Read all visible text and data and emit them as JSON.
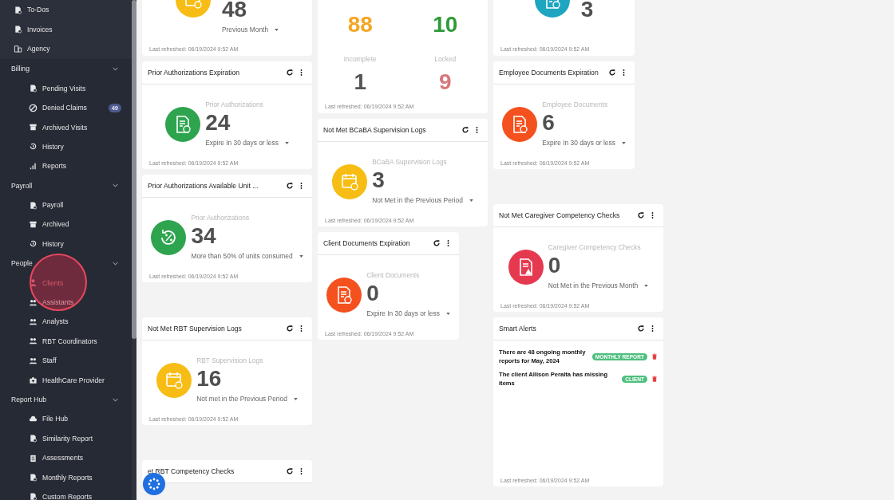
{
  "sidebar": {
    "top_items": [
      {
        "label": "To-Dos",
        "selected": false
      },
      {
        "label": "Invoices",
        "selected": false
      },
      {
        "label": "Agency",
        "selected": false
      }
    ],
    "groups": [
      {
        "label": "Billing",
        "expanded": true,
        "items": [
          {
            "label": "Pending Visits",
            "selected": false
          },
          {
            "label": "Denied Claims",
            "selected": false,
            "badge": "49"
          },
          {
            "label": "Archived Visits",
            "selected": false
          },
          {
            "label": "History",
            "selected": false
          },
          {
            "label": "Reports",
            "selected": false
          }
        ]
      },
      {
        "label": "Payroll",
        "expanded": true,
        "items": [
          {
            "label": "Payroll",
            "selected": false
          },
          {
            "label": "Archived",
            "selected": false
          },
          {
            "label": "History",
            "selected": false
          }
        ]
      },
      {
        "label": "People",
        "expanded": true,
        "items": [
          {
            "label": "Clients",
            "selected": true
          },
          {
            "label": "Assistants",
            "selected": false
          },
          {
            "label": "Analysts",
            "selected": false
          },
          {
            "label": "RBT Coordinators",
            "selected": false
          },
          {
            "label": "Staff",
            "selected": false
          },
          {
            "label": "HealthCare Provider",
            "selected": false
          }
        ]
      },
      {
        "label": "Report Hub",
        "expanded": true,
        "items": [
          {
            "label": "File Hub",
            "selected": false
          },
          {
            "label": "Similarity Report",
            "selected": false
          },
          {
            "label": "Assessments",
            "selected": false
          },
          {
            "label": "Monthly Reports",
            "selected": false
          },
          {
            "label": "Custom Reports",
            "selected": false
          }
        ]
      }
    ]
  },
  "columns": [
    {
      "cards": [
        {
          "kind": "partial",
          "color": "#f7bd14",
          "value": "48",
          "period": "Previous Month",
          "refreshed": "Last refreshed: 06/19/2024 9:52 AM"
        },
        {
          "kind": "stat",
          "title": "Prior Authorizations Expiration",
          "color": "#2ea44f",
          "caption": "Prior Authorizations",
          "value": "24",
          "period": "Expire In 30 days or less",
          "refreshed": "Last refreshed: 06/19/2024 9:52 AM"
        },
        {
          "kind": "stat",
          "title": "Prior Authorizations Available Unit ...",
          "color": "#2ea44f",
          "caption": "Prior Authorizations",
          "value": "34",
          "period": "More than 50% of units consumed",
          "refreshed": "Last refreshed: 06/19/2024 9:52 AM"
        },
        {
          "kind": "stat",
          "title": "Not Met RBT Supervision Logs",
          "color": "#f7bd14",
          "caption": "RBT Supervision Logs",
          "value": "16",
          "period": "Not met in the Previous Period",
          "refreshed": "Last refreshed: 06/19/2024 9:52 AM"
        },
        {
          "kind": "header",
          "title": "et RBT Competency Checks"
        }
      ]
    },
    {
      "cards": [
        {
          "kind": "grid",
          "stats": [
            {
              "value": "88",
              "color": "#f5a623"
            },
            {
              "value": "10",
              "color": "#2f9a3a"
            },
            {
              "label": "Incomplete",
              "value": "1",
              "color": "#555555"
            },
            {
              "label": "Locked",
              "value": "9",
              "color": "#d9777a"
            }
          ],
          "refreshed": "Last refreshed: 06/19/2024 9:52 AM"
        },
        {
          "kind": "stat",
          "title": "Not Met BCaBA Supervision Logs",
          "color": "#f7bd14",
          "caption": "BCaBA Supervision Logs",
          "value": "3",
          "period": "Not Met in the Previous Period",
          "refreshed": "Last refreshed: 06/19/2024 9:52 AM"
        },
        {
          "kind": "stat",
          "title": "Client Documents Expiration",
          "color": "#f4511e",
          "caption": "Client Documents",
          "value": "0",
          "period": "Expire In 30 days or less",
          "refreshed": "Last refreshed: 06/19/2024 9:52 AM"
        }
      ]
    },
    {
      "cards": [
        {
          "kind": "partial",
          "color": "#1ea5c0",
          "value": "3",
          "refreshed": "Last refreshed: 06/19/2024 9:52 AM"
        },
        {
          "kind": "stat",
          "title": "Employee Documents Expiration",
          "color": "#f4511e",
          "caption": "Employee Documents",
          "value": "6",
          "period": "Expire In 30 days or less",
          "refreshed": "Last refreshed: 06/19/2024 9:52 AM"
        },
        {
          "kind": "stat",
          "title": "Not Met Caregiver Competency Checks",
          "color": "#e53950",
          "caption": "Caregiver Competency Checks",
          "value": "0",
          "period": "Not Met in the Previous Month",
          "refreshed": "Last refreshed: 06/19/2024 9:52 AM"
        },
        {
          "kind": "alerts",
          "title": "Smart Alerts",
          "alerts": [
            {
              "text": "There are 48 ongoing monthly reports for May, 2024",
              "tag": "MONTHLY REPORT"
            },
            {
              "text": "The client Allison Peralta has missing items",
              "tag": "CLIENT"
            }
          ],
          "refreshed": "Last refreshed: 06/19/2024 9:52 AM"
        }
      ]
    }
  ]
}
